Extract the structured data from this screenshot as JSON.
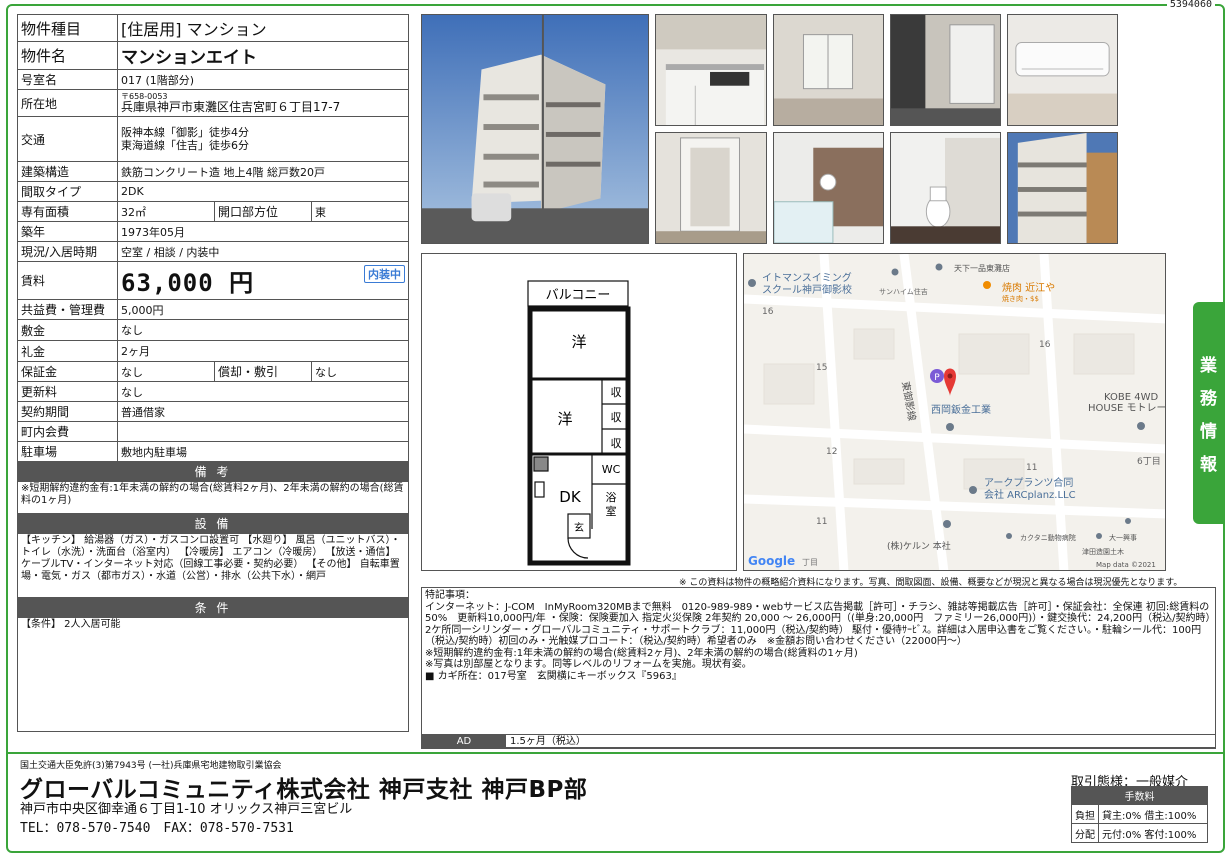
{
  "doc_id": "5394060",
  "property": {
    "type_label": "物件種目",
    "type_value": "[住居用] マンション",
    "name_label": "物件名",
    "name_value": "マンションエイト",
    "room_label": "号室名",
    "room_value": "017 (1階部分)",
    "location_label": "所在地",
    "zip": "〒658-0053",
    "address": "兵庫県神戸市東灘区住吉宮町６丁目17-7",
    "transport_label": "交通",
    "transport_1": "阪神本線「御影」徒歩4分",
    "transport_2": "東海道線「住吉」徒歩6分",
    "structure_label": "建築構造",
    "structure_value": "鉄筋コンクリート造 地上4階 総戸数20戸",
    "layout_label": "間取タイプ",
    "layout_value": "2DK",
    "area_label": "専有面積",
    "area_value": "32㎡",
    "opening_label": "開口部方位",
    "opening_value": "東",
    "built_label": "築年",
    "built_value": "1973年05月",
    "status_label": "現況/入居時期",
    "status_value": "空室 / 相談 / 内装中",
    "rent_label": "賃料",
    "rent_value": "63,000 円",
    "rent_badge": "内装中",
    "common_fee_label": "共益費・管理費",
    "common_fee_value": "5,000円",
    "deposit_label": "敷金",
    "deposit_value": "なし",
    "key_money_label": "礼金",
    "key_money_value": "2ヶ月",
    "guarantee_label": "保証金",
    "guarantee_value": "なし",
    "amort_label": "償却・敷引",
    "amort_value": "なし",
    "renewal_label": "更新料",
    "renewal_value": "なし",
    "contract_label": "契約期間",
    "contract_value": "普通借家",
    "town_fee_label": "町内会費",
    "town_fee_value": "",
    "parking_label": "駐車場",
    "parking_value": "敷地内駐車場"
  },
  "sections": {
    "remarks_title": "備 考",
    "remarks_text": "※短期解約違約金有:1年未満の解約の場合(総賃料2ヶ月)、2年未満の解約の場合(総賃料の1ヶ月)",
    "equipment_title": "設 備",
    "equipment_text": "【キッチン】 給湯器（ガス）・ガスコンロ設置可 【水廻り】 風呂（ユニットバス）・トイレ（水洗）・洗面台（浴室内） 【冷暖房】 エアコン（冷暖房） 【放送・通信】 ケーブルTV・インターネット対応（回線工事必要・契約必要） 【その他】 自転車置場・電気・ガス（都市ガス）・水道（公営）・排水（公共下水）・網戸",
    "conditions_title": "条 件",
    "conditions_text": "【条件】 2人入居可能"
  },
  "floorplan": {
    "balcony": "バルコニー",
    "room1": "洋",
    "room2": "洋",
    "storage1": "収",
    "storage2": "収",
    "storage3": "収",
    "wc": "WC",
    "dk": "DK",
    "bath_1": "浴",
    "bath_2": "室",
    "entrance": "玄"
  },
  "map": {
    "labels": {
      "swim": "イトマンスイミング",
      "swim2": "スクール神戸御影校",
      "tenka": "天下一品東灘店",
      "sunhaim": "サンハイム住吉",
      "yakiniku": "焼肉 近江や",
      "yakiniku_sub": "焼き肉・$$",
      "b16a": "16",
      "b16b": "16",
      "b15": "15",
      "b12": "12",
      "b11a": "11",
      "b11b": "11",
      "c6": "6丁目",
      "road": "東御影線",
      "nishioka": "西岡鈑金工業",
      "kobe1": "KOBE 4WD",
      "kobe2": "HOUSE モトレージ",
      "arc1": "アークプランツ合同",
      "arc2": "会社 ARCplanz.LLC",
      "kerun": "(株)ケルン 本社",
      "kakutani": "カクタニ動物病院",
      "daiichi": "大一興事",
      "tsuda": "津田造園土木",
      "google": "Google",
      "chome": "丁目",
      "mapdata": "Map data ©2021",
      "p": "P"
    }
  },
  "disclaimer": "※ この資料は物件の概略紹介資料になります。写真、間取図面、設備、概要などが現況と異なる場合は現況優先となります。",
  "notes": {
    "title": "特記事項：",
    "body": "インターネット：J-COM　InMyRoom320MBまで無料　0120-989-989・webサービス広告掲載［許可］・チラシ、雑誌等掲載広告［許可］・保証会社：全保連 初回:総賃料の50%　更新料10,000円/年 ・保険：保険要加入 指定火災保険 2年契約 20,000 ～ 26,000円（(単身:20,000円　ファミリー26,000円)）・鍵交換代：24,200円（税込/契約時）2ケ所同一シリンダー・グローバルコミュニティ・サポートクラブ：11,000円（税込/契約時） 駆付・優待ｻｰﾋﾞｽ。詳細は入居申込書をご覧ください。・駐輪シール代：100円（税込/契約時）初回のみ・光触媒プロコート：（税込/契約時）希望者のみ　※金額お問い合わせください（22000円～）\n※短期解約違約金有:1年未満の解約の場合(総賃料2ヶ月)、2年未満の解約の場合(総賃料の1ヶ月)\n※写真は別部屋となります。同等レベルのリフォームを実施。現状有姿。\n■ カギ所在：017号室　玄関横にキーボックス『5963』",
    "ad_label": "AD",
    "ad_value": "1.5ヶ月（税込）"
  },
  "side_tab": [
    "業",
    "務",
    "情",
    "報"
  ],
  "company": {
    "license": "国土交通大臣免許(3)第7943号 (一社)兵庫県宅地建物取引業協会",
    "name": "グローバルコミュニティ株式会社 神戸支社 神戸BP部",
    "address": "神戸市中央区御幸通６丁目1-10 オリックス神戸三宮ビル",
    "tel": "TEL：078-570-7540　FAX：078-570-7531"
  },
  "fee": {
    "title": "取引態様：一般媒介",
    "header": "手数料",
    "burden_label": "負担",
    "burden_value": "貸主:0% 借主:100%",
    "split_label": "分配",
    "split_value": "元付:0% 客付:100%"
  },
  "colors": {
    "frame": "#3aa53a",
    "section_bg": "#555555",
    "badge": "#3a7bd5",
    "map_pin": "#e53935"
  }
}
